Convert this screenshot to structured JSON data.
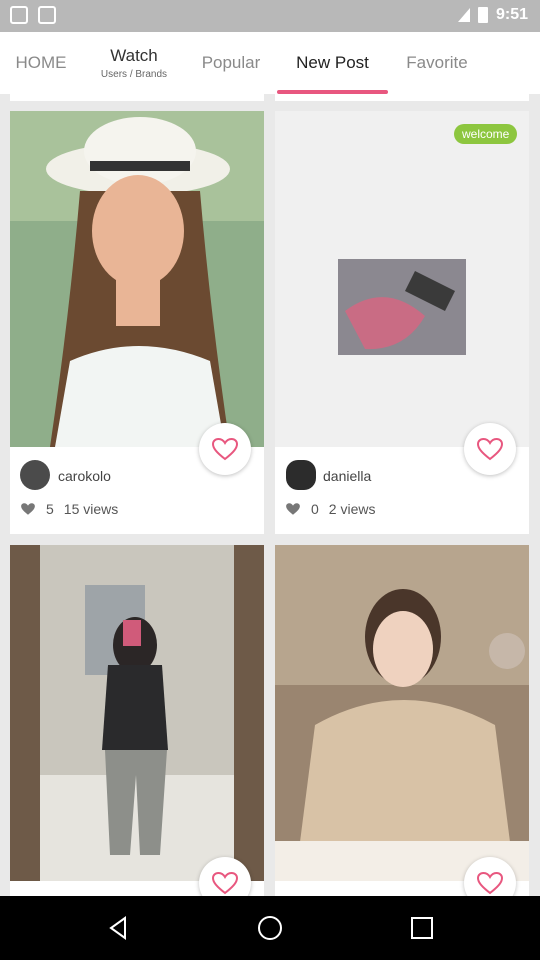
{
  "status_bar": {
    "time": "9:51"
  },
  "tabs": [
    {
      "label": "HOME"
    },
    {
      "label": "Watch",
      "sub": "Users / Brands"
    },
    {
      "label": "Popular"
    },
    {
      "label": "New Post"
    },
    {
      "label": "Favorite"
    }
  ],
  "posts": [
    {
      "username": "carokolo",
      "likes": "5",
      "views": "15 views"
    },
    {
      "username": "daniella",
      "likes": "0",
      "views": "2 views",
      "badge": "welcome"
    },
    {
      "username": "",
      "likes": "",
      "views": ""
    },
    {
      "username": "",
      "likes": "",
      "views": ""
    }
  ],
  "colors": {
    "accent": "#e8577f",
    "badge": "#8dc63f"
  }
}
